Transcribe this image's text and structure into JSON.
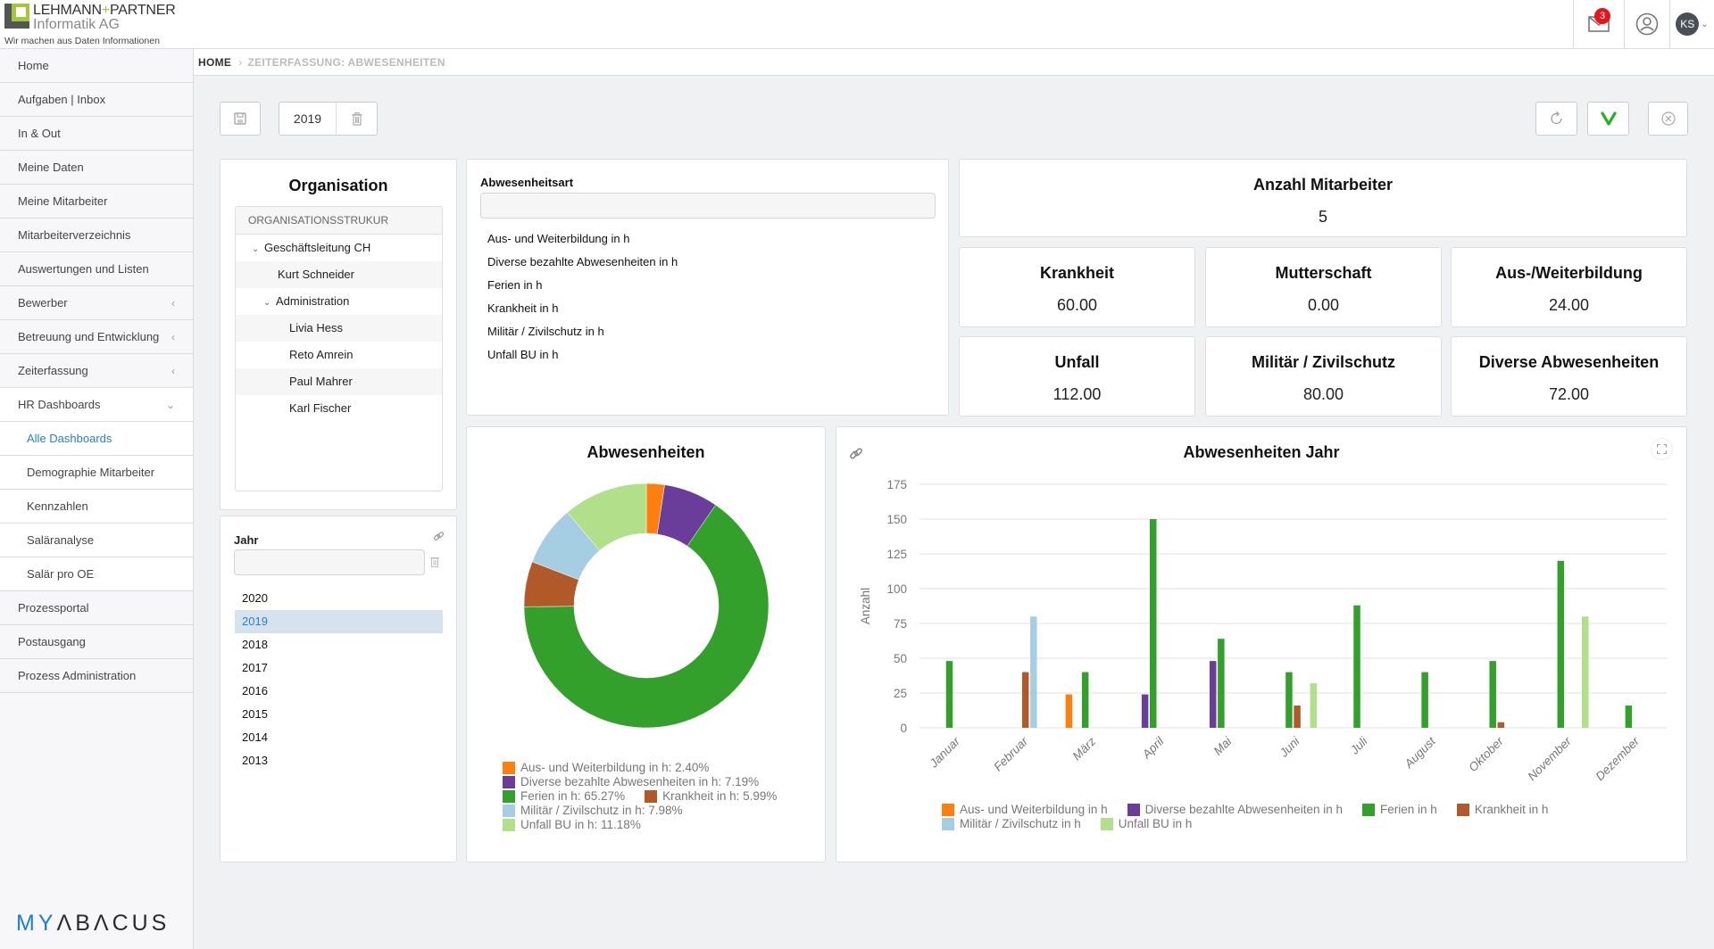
{
  "header": {
    "logo_brand": "LEHMANN",
    "logo_plus": "+",
    "logo_partner": "PARTNER",
    "logo_sub": "Informatik AG",
    "logo_tagline": "Wir machen aus Daten Informationen",
    "mail_badge": "3",
    "avatar_initials": "KS"
  },
  "sidebar": {
    "items": [
      {
        "label": "Home",
        "chev": ""
      },
      {
        "label": "Aufgaben | Inbox",
        "chev": ""
      },
      {
        "label": "In & Out",
        "chev": ""
      },
      {
        "label": "Meine Daten",
        "chev": ""
      },
      {
        "label": "Meine Mitarbeiter",
        "chev": ""
      },
      {
        "label": "Mitarbeiterverzeichnis",
        "chev": ""
      },
      {
        "label": "Auswertungen und Listen",
        "chev": ""
      },
      {
        "label": "Bewerber",
        "chev": "‹"
      },
      {
        "label": "Betreuung und Entwicklung",
        "chev": "‹"
      },
      {
        "label": "Zeiterfassung",
        "chev": "‹"
      },
      {
        "label": "HR Dashboards",
        "chev": "⌄"
      },
      {
        "label": "Alle Dashboards",
        "chev": ""
      },
      {
        "label": "Demographie Mitarbeiter",
        "chev": ""
      },
      {
        "label": "Kennzahlen",
        "chev": ""
      },
      {
        "label": "Saläranalyse",
        "chev": ""
      },
      {
        "label": "Salär pro OE",
        "chev": ""
      },
      {
        "label": "Prozessportal",
        "chev": ""
      },
      {
        "label": "Postausgang",
        "chev": ""
      },
      {
        "label": "Prozess Administration",
        "chev": ""
      }
    ],
    "footer_logo_my": "MY",
    "footer_logo_rest": "ΛBΛCUS"
  },
  "breadcrumb": {
    "home": "HOME",
    "separator": "›",
    "current": "ZEITERFASSUNG: ABWESENHEITEN"
  },
  "toolbar": {
    "year_value": "2019",
    "accent_green": "#1db31d"
  },
  "organisation": {
    "title": "Organisation",
    "tree_header": "ORGANISATIONSSTRUKUR",
    "nodes": [
      {
        "label": "Geschäftsleitung CH",
        "expanded": true
      },
      {
        "label": "Kurt Schneider"
      },
      {
        "label": "Administration",
        "expanded": true
      },
      {
        "label": "Livia Hess"
      },
      {
        "label": "Reto Amrein"
      },
      {
        "label": "Paul Mahrer"
      },
      {
        "label": "Karl Fischer"
      }
    ]
  },
  "jahr": {
    "label": "Jahr",
    "input_value": "",
    "years": [
      "2020",
      "2019",
      "2018",
      "2017",
      "2016",
      "2015",
      "2014",
      "2013"
    ],
    "selected": "2019"
  },
  "abwesenheitsart": {
    "label": "Abwesenheitsart",
    "input_value": "",
    "items": [
      "Aus- und Weiterbildung in h",
      "Diverse bezahlte Abwesenheiten in h",
      "Ferien in h",
      "Krankheit in h",
      "Militär / Zivilschutz in h",
      "Unfall BU in h"
    ]
  },
  "kpis": {
    "employees": {
      "title": "Anzahl Mitarbeiter",
      "value": "5"
    },
    "tiles": [
      {
        "title": "Krankheit",
        "value": "60.00"
      },
      {
        "title": "Mutterschaft",
        "value": "0.00"
      },
      {
        "title": "Aus-/Weiterbildung",
        "value": "24.00"
      },
      {
        "title": "Unfall",
        "value": "112.00"
      },
      {
        "title": "Militär / Zivilschutz",
        "value": "80.00"
      },
      {
        "title": "Diverse Abwesenheiten",
        "value": "72.00"
      }
    ]
  },
  "chart_data": [
    {
      "type": "pie",
      "title": "Abwesenheiten",
      "donut": true,
      "slices": [
        {
          "label": "Aus- und Weiterbildung in h",
          "percent": 2.4,
          "color": "#ff7f0e"
        },
        {
          "label": "Diverse bezahlte Abwesenheiten in h",
          "percent": 7.19,
          "color": "#6a3d9a"
        },
        {
          "label": "Ferien in h",
          "percent": 65.27,
          "color": "#33a02c"
        },
        {
          "label": "Krankheit in h",
          "percent": 5.99,
          "color": "#b15928"
        },
        {
          "label": "Militär / Zivilschutz in h",
          "percent": 7.98,
          "color": "#a6cee3"
        },
        {
          "label": "Unfall BU in h",
          "percent": 11.18,
          "color": "#b2df8a"
        }
      ],
      "legend_labels": [
        "Aus- und Weiterbildung in h: 2.40%",
        "Diverse bezahlte Abwesenheiten in h: 7.19%",
        "Ferien in h: 65.27%",
        "Krankheit in h: 5.99%",
        "Militär / Zivilschutz in h: 7.98%",
        "Unfall BU in h: 11.18%"
      ],
      "legend_position": "bottom"
    },
    {
      "type": "bar",
      "title": "Abwesenheiten Jahr",
      "xlabel": "",
      "ylabel": "Anzahl",
      "ylim": [
        0,
        175
      ],
      "yticks": [
        0,
        25,
        50,
        75,
        100,
        125,
        150,
        175
      ],
      "grid": true,
      "legend_position": "bottom",
      "categories": [
        "Januar",
        "Februar",
        "März",
        "April",
        "Mai",
        "Juni",
        "Juli",
        "August",
        "Oktober",
        "November",
        "Dezember"
      ],
      "series": [
        {
          "name": "Aus- und Weiterbildung in h",
          "color": "#ff7f0e",
          "values": [
            0,
            0,
            24,
            0,
            0,
            0,
            0,
            0,
            0,
            0,
            0
          ]
        },
        {
          "name": "Diverse bezahlte Abwesenheiten in h",
          "color": "#6a3d9a",
          "values": [
            0,
            0,
            0,
            24,
            48,
            0,
            0,
            0,
            0,
            0,
            0
          ]
        },
        {
          "name": "Ferien in h",
          "color": "#33a02c",
          "values": [
            48,
            0,
            40,
            150,
            64,
            40,
            88,
            40,
            48,
            120,
            16
          ]
        },
        {
          "name": "Krankheit in h",
          "color": "#b15928",
          "values": [
            0,
            40,
            0,
            0,
            0,
            16,
            0,
            0,
            4,
            0,
            0
          ]
        },
        {
          "name": "Militär / Zivilschutz in h",
          "color": "#a6cee3",
          "values": [
            0,
            80,
            0,
            0,
            0,
            0,
            0,
            0,
            0,
            0,
            0
          ]
        },
        {
          "name": "Unfall BU in h",
          "color": "#b2df8a",
          "values": [
            0,
            0,
            0,
            0,
            0,
            32,
            0,
            0,
            0,
            80,
            0
          ]
        }
      ]
    }
  ]
}
